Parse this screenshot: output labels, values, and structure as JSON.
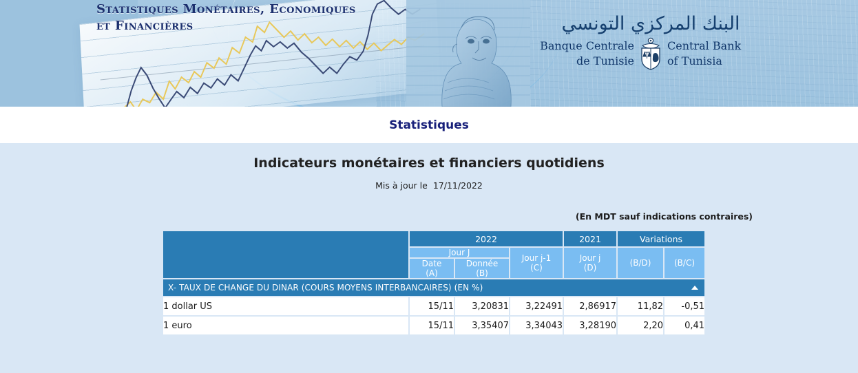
{
  "banner": {
    "title_line1": "Statistiques Monétaires, Economiques",
    "title_line2": "et Financières",
    "bank_arabic": "البنك المركزي التونسي",
    "bank_fr_line1": "Banque Centrale",
    "bank_fr_line2": "de Tunisie",
    "bank_en_line1": "Central Bank",
    "bank_en_line2": "of Tunisia",
    "colors": {
      "banner_blue": "#9cc2de",
      "title_navy": "#1b2f6e"
    }
  },
  "page": {
    "title": "Statistiques",
    "doc_title": "Indicateurs monétaires et financiers quotidiens",
    "updated_label": "Mis à jour le",
    "updated_date": "17/11/2022",
    "unit_note": "(En MDT sauf indications contraires)",
    "colors": {
      "background": "#d9e7f5",
      "header_dark_blue": "#2a7cb4",
      "header_light_blue": "#7abdf2",
      "page_title": "#18207a"
    }
  },
  "table": {
    "header": {
      "corner_blank": "",
      "group_2022": "2022",
      "group_2021": "2021",
      "group_variations": "Variations",
      "jour_j": "Jour J",
      "date_a_line1": "Date",
      "date_a_line2": "(A)",
      "donnee_b_line1": "Donnée",
      "donnee_b_line2": "(B)",
      "jour_j1_c_line1": "Jour j-1",
      "jour_j1_c_line2": "(C)",
      "jour_j_d_line1": "Jour j",
      "jour_j_d_line2": "(D)",
      "var_bd": "(B/D)",
      "var_bc": "(B/C)"
    },
    "sections": [
      {
        "label": "X- TAUX DE CHANGE DU DINAR (COURS MOYENS INTERBANCAIRES) (EN %)",
        "toggle_icon": "triangle-up-icon",
        "rows": [
          {
            "label": "1 dollar US",
            "date_a": "15/11",
            "donnee_b": "3,20831",
            "jour_j1_c": "3,22491",
            "jour_j_d": "2,86917",
            "var_bd": "11,82",
            "var_bc": "-0,51"
          },
          {
            "label": "1 euro",
            "date_a": "15/11",
            "donnee_b": "3,35407",
            "jour_j1_c": "3,34043",
            "jour_j_d": "3,28190",
            "var_bd": "2,20",
            "var_bc": "0,41"
          }
        ]
      }
    ]
  }
}
